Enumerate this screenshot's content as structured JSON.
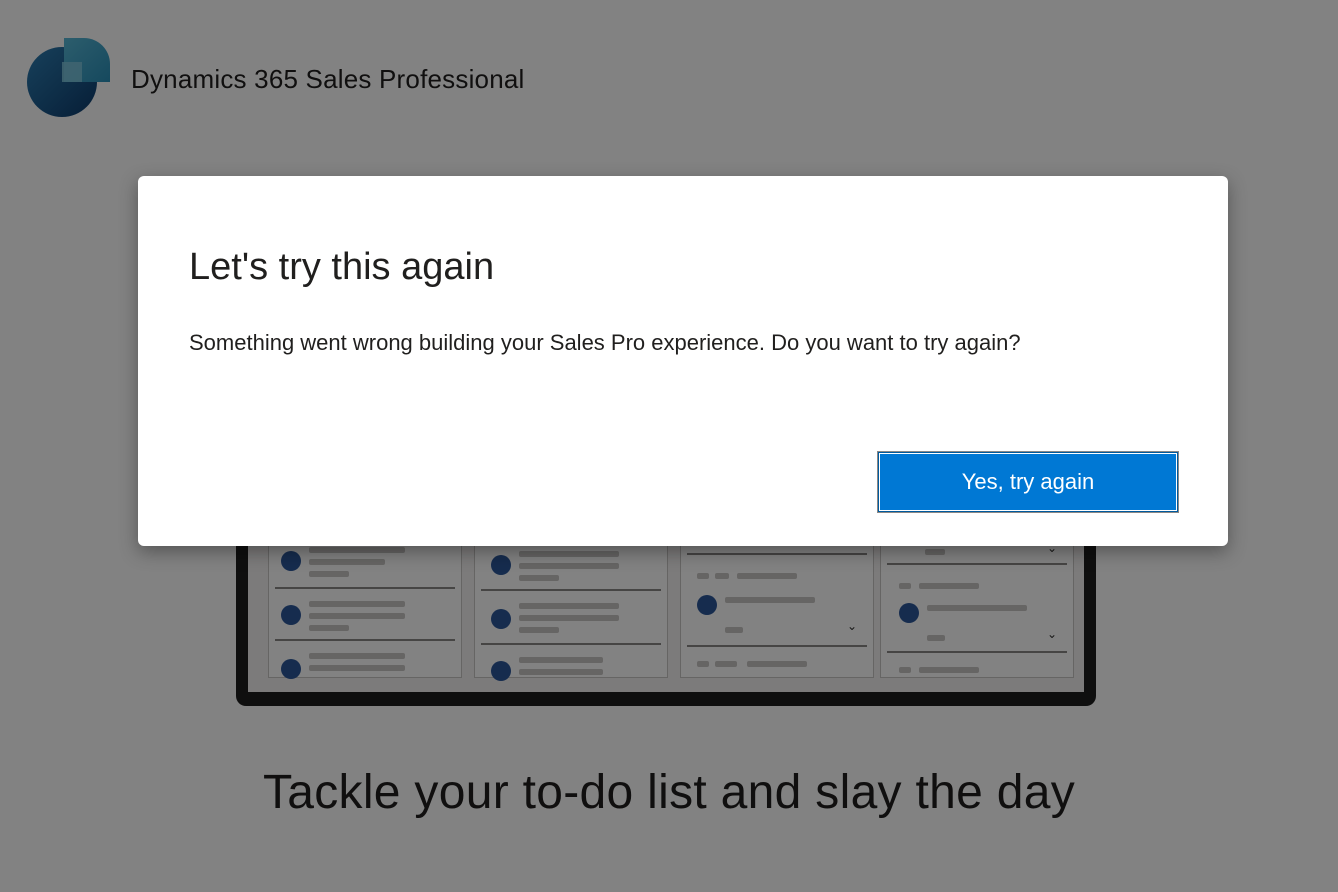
{
  "header": {
    "app_title": "Dynamics 365 Sales Professional",
    "logo_icon": "dynamics-365-logo-icon"
  },
  "background": {
    "tagline": "Tackle your to-do list and slay the day",
    "illustration_icon": "device-mockup-illustration"
  },
  "dialog": {
    "title": "Let's try this again",
    "message": "Something went wrong building your Sales Pro experience. Do you want to try again?",
    "primary_button_label": "Yes, try again"
  },
  "colors": {
    "accent": "#0078d4",
    "overlay": "rgba(0,0,0,0.49)",
    "logo_dark": "#1b4f7a",
    "logo_light": "#2a8fb8"
  }
}
